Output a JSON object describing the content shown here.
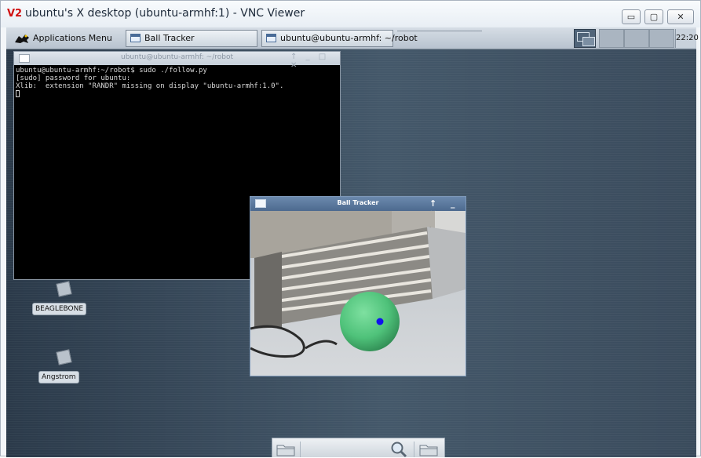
{
  "vnc": {
    "title": "ubuntu's X desktop (ubuntu-armhf:1) - VNC Viewer",
    "logo_text": "V2",
    "min_label": "▭",
    "max_label": "▢",
    "close_label": "✕"
  },
  "panel": {
    "app_menu_label": "Applications Menu",
    "tasks": [
      {
        "label": "Ball Tracker"
      },
      {
        "label": "ubuntu@ubuntu-armhf: ~/robot"
      }
    ],
    "clock": "22:20"
  },
  "terminal": {
    "title": "ubuntu@ubuntu-armhf: ~/robot",
    "controls": "↑ _ □ ✕",
    "lines": [
      "ubuntu@ubuntu-armhf:~/robot$ sudo ./follow.py",
      "[sudo] password for ubuntu:",
      "Xlib:  extension \"RANDR\" missing on display \"ubuntu-armhf:1.0\"."
    ]
  },
  "desktop_icons": [
    {
      "label": "BEAGLEBONE"
    },
    {
      "label": "Angstrom"
    }
  ],
  "ball_tracker": {
    "title": "Ball Tracker",
    "controls": "↑ _ ✕"
  },
  "colors": {
    "ball_green": "#4fc27a",
    "marker_blue": "#1111ee",
    "titlebar_blue": "#4d6a8f"
  },
  "dock": {
    "left_icon": "folder-icon",
    "search_icon": "search-icon",
    "right_icon": "folder-icon"
  }
}
